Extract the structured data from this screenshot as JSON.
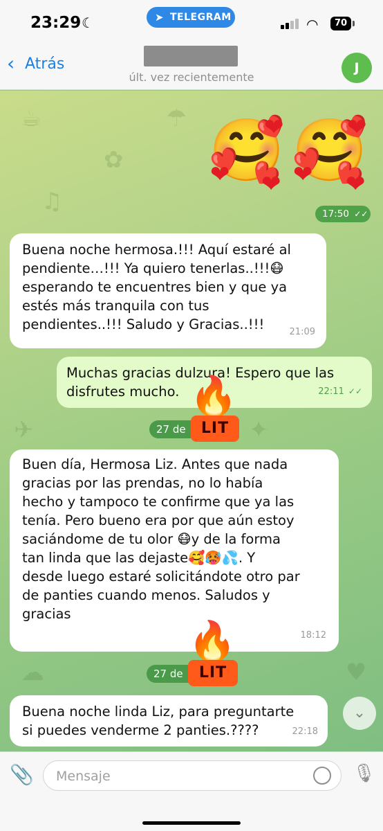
{
  "status_bar": {
    "time": "23:29",
    "moon_icon": "☾",
    "telegram_label": "TELEGRAM",
    "battery": "70"
  },
  "header": {
    "back_label": "Atrás",
    "last_seen": "últ. vez recientemente",
    "avatar_initial": "J"
  },
  "messages": [
    {
      "id": "m0",
      "direction": "out",
      "content": "emoji",
      "emojis": [
        "🥰",
        "🥰"
      ],
      "time": "17:50",
      "status": "read"
    },
    {
      "id": "m1",
      "direction": "in",
      "lines": [
        "Buena noche hermosa.!!! Aquí estaré al",
        "pendiente…!!! Ya quiero tenerlas..!!!😷",
        "esperando te encuentres bien y que ya",
        "estés más tranquila con tus",
        "pendientes..!!! Saludo y Gracias..!!!"
      ],
      "time": "21:09"
    },
    {
      "id": "m2",
      "direction": "out",
      "lines": [
        "Muchas gracias dulzura! Espero que las",
        "disfrutes mucho."
      ],
      "time": "22:11",
      "status": "read"
    },
    {
      "id": "m3",
      "direction": "in",
      "lines": [
        "Buen día, Hermosa Liz. Antes que nada",
        "gracias por las prendas, no lo había",
        "hecho y tampoco te confirme que ya las",
        "tenía. Pero bueno era por que aún estoy",
        "saciándome de tu olor 😷y de la forma",
        "tan linda que las dejaste🥰🥵💦. Y",
        "desde luego estaré solicitándote otro par",
        "de panties cuando menos. Saludos  y",
        "gracias"
      ],
      "time": "18:12"
    },
    {
      "id": "m4",
      "direction": "in",
      "lines": [
        "Buena noche linda Liz, para preguntarte",
        "si puedes venderme 2 panties.????"
      ],
      "time": "22:18"
    }
  ],
  "date_separators": [
    "27 de",
    "27 de"
  ],
  "stickers": {
    "lit_text": "LIT",
    "fire": "🔥"
  },
  "composer": {
    "placeholder": "Mensaje"
  },
  "colors": {
    "accent": "#1d7fe0",
    "outgoing_bubble": "#e3fbc9",
    "incoming_bubble": "#ffffff",
    "read_check": "#4fa14a",
    "avatar": "#5fbd4f"
  }
}
